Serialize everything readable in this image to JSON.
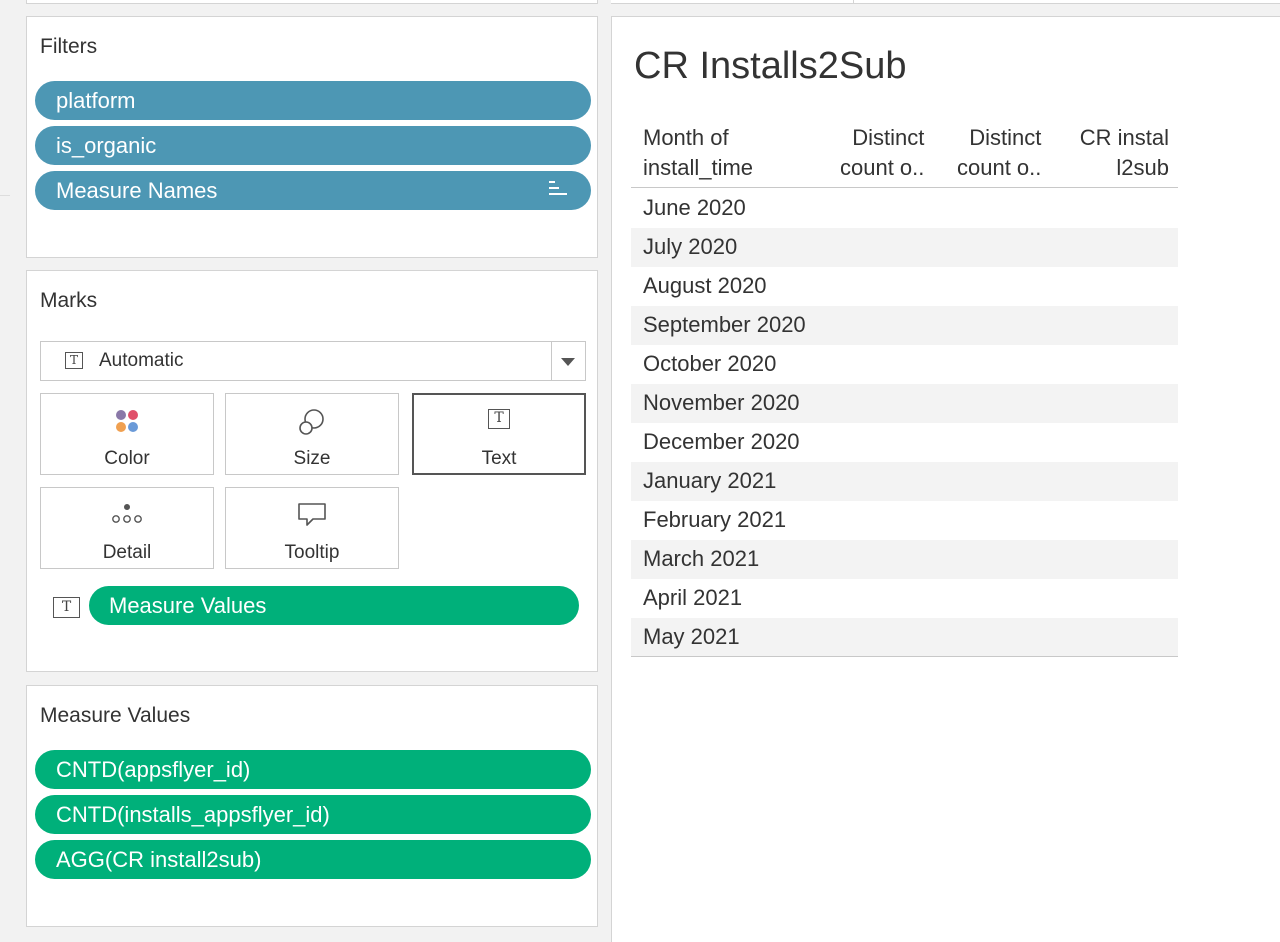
{
  "filters": {
    "title": "Filters",
    "items": [
      {
        "label": "platform"
      },
      {
        "label": "is_organic"
      },
      {
        "label": "Measure Names"
      }
    ]
  },
  "marks": {
    "title": "Marks",
    "mark_type": "Automatic",
    "buttons": {
      "color": "Color",
      "size": "Size",
      "text": "Text",
      "detail": "Detail",
      "tooltip": "Tooltip"
    },
    "text_field": "Measure Values"
  },
  "measure_values": {
    "title": "Measure Values",
    "items": [
      {
        "label": "CNTD(appsflyer_id)"
      },
      {
        "label": "CNTD(installs_appsflyer_id)"
      },
      {
        "label": "AGG(CR install2sub)"
      }
    ]
  },
  "view": {
    "title": "CR Installs2Sub",
    "columns": {
      "month": [
        "Month of",
        "install_time"
      ],
      "col2": [
        "Distinct",
        "count o.."
      ],
      "col3": [
        "Distinct",
        "count o.."
      ],
      "col4": [
        "CR instal",
        "l2sub"
      ]
    },
    "rows": [
      "June 2020",
      "July 2020",
      "August 2020",
      "September 2020",
      "October 2020",
      "November 2020",
      "December 2020",
      "January 2021",
      "February 2021",
      "March 2021",
      "April 2021",
      "May 2021"
    ]
  },
  "colors": {
    "dimension_pill": "#4d97b4",
    "measure_pill": "#00b07a"
  },
  "icons": {
    "sort": "sort-descending-icon",
    "color": "color-dots-icon",
    "size": "size-circles-icon",
    "text": "text-t-icon",
    "detail": "detail-dots-icon",
    "tooltip": "speech-bubble-icon",
    "dropdown": "chevron-down-icon"
  }
}
